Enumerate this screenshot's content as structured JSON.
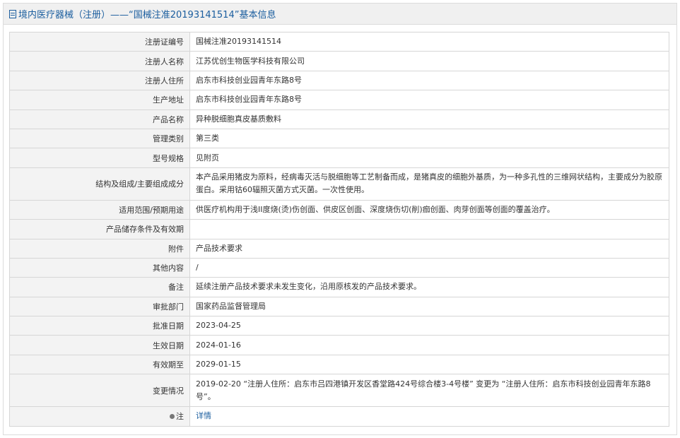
{
  "header": {
    "title": "境内医疗器械（注册）——“国械注准20193141514”基本信息"
  },
  "rows": [
    {
      "label": "注册证编号",
      "value": "国械注准20193141514"
    },
    {
      "label": "注册人名称",
      "value": "江苏优创生物医学科技有限公司"
    },
    {
      "label": "注册人住所",
      "value": "启东市科技创业园青年东路8号"
    },
    {
      "label": "生产地址",
      "value": "启东市科技创业园青年东路8号"
    },
    {
      "label": "产品名称",
      "value": "异种脱细胞真皮基质敷料"
    },
    {
      "label": "管理类别",
      "value": "第三类"
    },
    {
      "label": "型号规格",
      "value": "见附页"
    },
    {
      "label": "结构及组成/主要组成成分",
      "value": "本产品采用猪皮为原料，经病毒灭活与脱细胞等工艺制备而成，是猪真皮的细胞外基质，为一种多孔性的三维网状结构，主要成分为胶原蛋白。采用钴60辐照灭菌方式灭菌。一次性使用。"
    },
    {
      "label": "适用范围/预期用途",
      "value": "供医疗机构用于浅II度烧(烫)伤创面、供皮区创面、深度烧伤切(削)痂创面、肉芽创面等创面的覆盖治疗。"
    },
    {
      "label": "产品储存条件及有效期",
      "value": ""
    },
    {
      "label": "附件",
      "value": "产品技术要求"
    },
    {
      "label": "其他内容",
      "value": "/"
    },
    {
      "label": "备注",
      "value": "延续注册产品技术要求未发生变化，沿用原核发的产品技术要求。"
    },
    {
      "label": "审批部门",
      "value": "国家药品监督管理局"
    },
    {
      "label": "批准日期",
      "value": "2023-04-25"
    },
    {
      "label": "生效日期",
      "value": "2024-01-16"
    },
    {
      "label": "有效期至",
      "value": "2029-01-15"
    },
    {
      "label": "变更情况",
      "value": "2019-02-20 “注册人住所：启东市吕四港镇开发区香堂路424号综合楼3-4号楼” 变更为 “注册人住所：启东市科技创业园青年东路8号”。"
    }
  ],
  "note": {
    "label": "注",
    "link_text": "详情",
    "icon": "pin-icon"
  }
}
